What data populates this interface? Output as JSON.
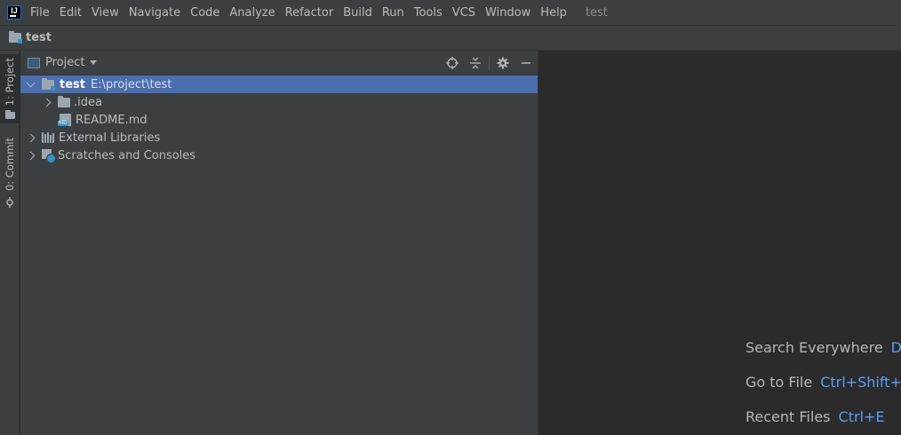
{
  "menu": {
    "items": [
      "File",
      "Edit",
      "View",
      "Navigate",
      "Code",
      "Analyze",
      "Refactor",
      "Build",
      "Run",
      "Tools",
      "VCS",
      "Window",
      "Help"
    ],
    "project_title": "test"
  },
  "navbar": {
    "crumb": "test"
  },
  "stripe": {
    "project_tab": "1: Project",
    "commit_tab": "0: Commit"
  },
  "project_panel": {
    "title": "Project",
    "tree": {
      "root": {
        "name": "test",
        "path": "E:\\project\\test"
      },
      "idea": ".idea",
      "readme": "README.md",
      "external_libraries": "External Libraries",
      "scratches": "Scratches and Consoles"
    }
  },
  "editor_hints": [
    {
      "label": "Search Everywhere",
      "key": "Double Shift"
    },
    {
      "label": "Go to File",
      "key": "Ctrl+Shift+N"
    },
    {
      "label": "Recent Files",
      "key": "Ctrl+E"
    }
  ],
  "colors": {
    "selection": "#4b6eaf",
    "shortcut": "#589df6",
    "module_badge": "#3592c4"
  }
}
